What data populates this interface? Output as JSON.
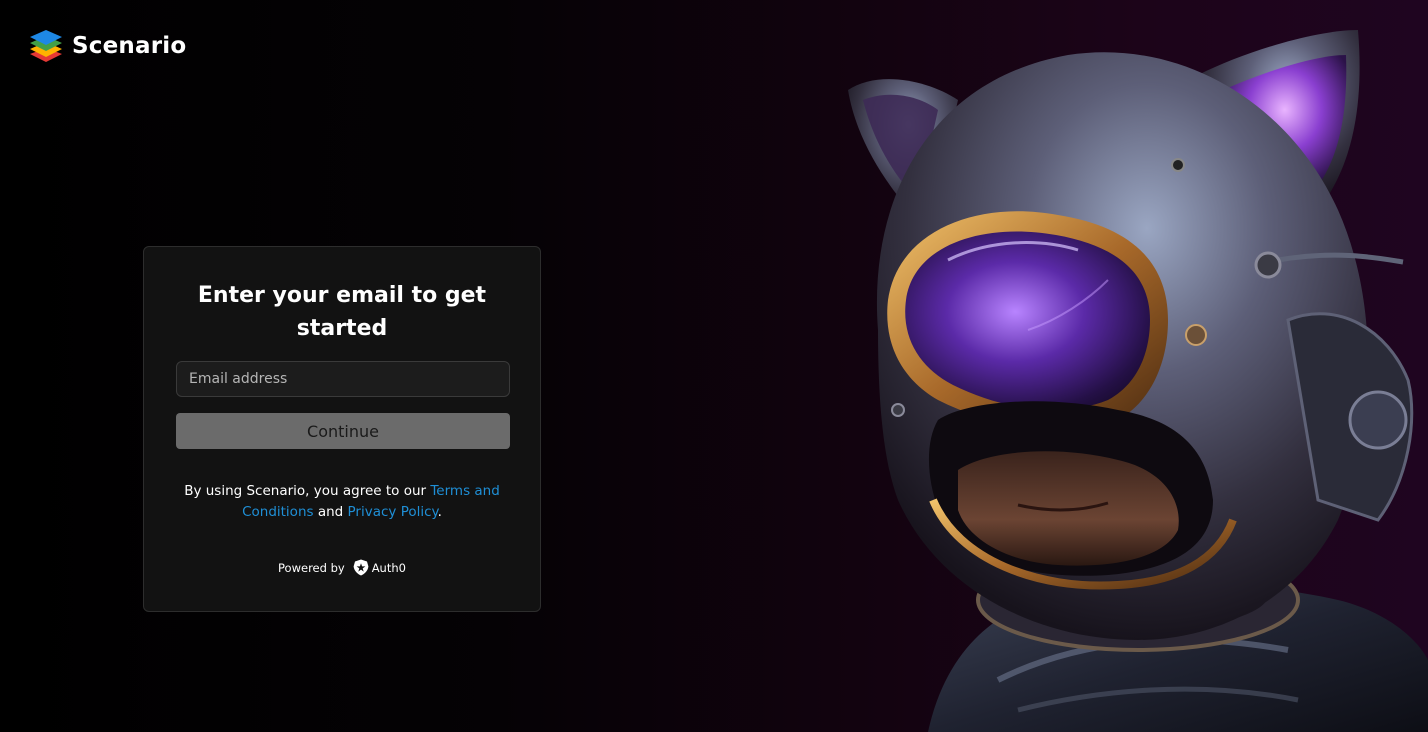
{
  "brand": {
    "name": "Scenario",
    "logo_icon": "scenario-logo-icon"
  },
  "login": {
    "title": "Enter your email to get started",
    "email_placeholder": "Email address",
    "email_value": "",
    "continue_label": "Continue",
    "terms_prefix": "By using Scenario, you agree to our ",
    "terms_link": "Terms and Conditions",
    "terms_and": " and ",
    "privacy_link": "Privacy Policy",
    "terms_suffix": ".",
    "powered_by": "Powered by",
    "provider": "Auth0",
    "provider_icon": "auth0-shield-icon"
  },
  "hero": {
    "icon": "astronaut-cat-helmet-illustration"
  },
  "colors": {
    "link": "#1f8fd6",
    "card_bg": "#121212",
    "button_bg": "#6b6b6b",
    "page_bg_right": "#1f0520"
  }
}
